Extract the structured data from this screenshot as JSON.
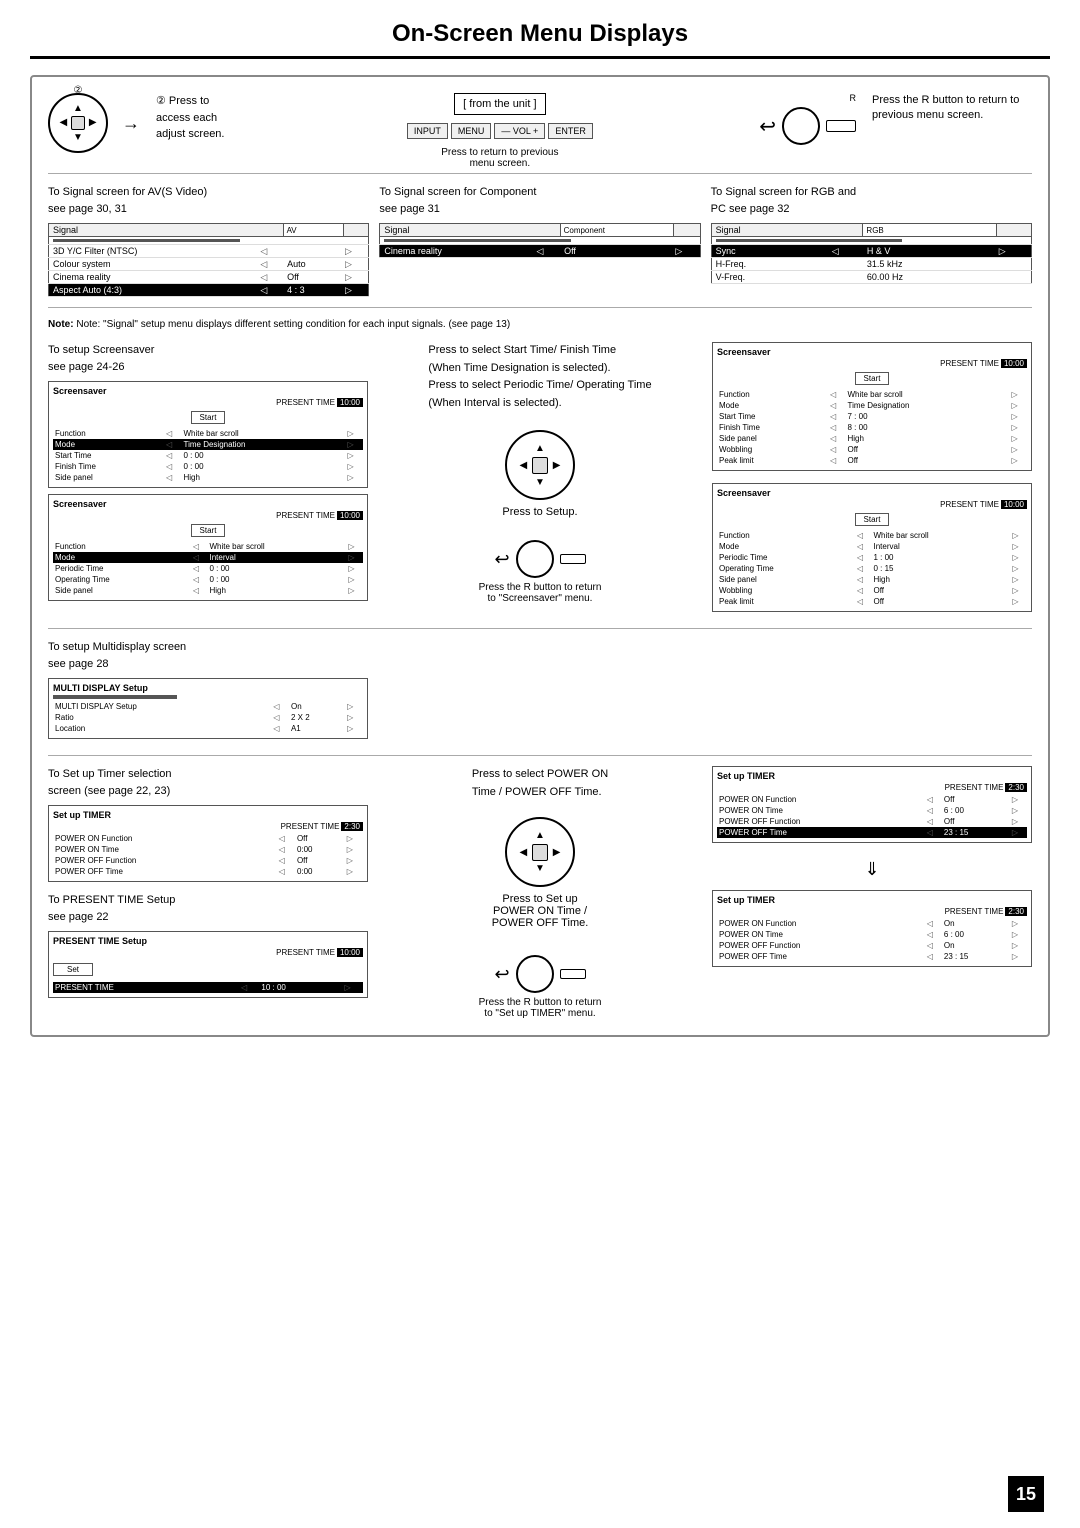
{
  "title": "On-Screen Menu Displays",
  "page_number": "15",
  "top": {
    "press_text_1": "② Press to",
    "press_text_2": "access each",
    "press_text_3": "adjust screen.",
    "from_unit_label": "[ from the unit ]",
    "unit_buttons": [
      "INPUT",
      "MENU",
      "—VOL+",
      "ENTER"
    ],
    "press_return": "Press to return to previous",
    "menu_screen": "menu screen.",
    "r_button_text": "Press the R button to return to previous menu screen."
  },
  "signal": {
    "av": {
      "label1": "To Signal screen for AV(S Video)",
      "label2": "see page 30, 31",
      "tag": "AV",
      "rows": [
        {
          "lbl": "Signal",
          "val": "AV",
          "tag": true
        },
        {
          "lbl": "3D Y/C Filter (NTSC)",
          "val": ""
        },
        {
          "lbl": "Colour system",
          "val": "Auto"
        },
        {
          "lbl": "Cinema reality",
          "val": "Off"
        },
        {
          "lbl": "Aspect Auto (4:3)",
          "val": "4 : 3"
        }
      ]
    },
    "component": {
      "label1": "To Signal screen for Component",
      "label2": "see page 31",
      "tag": "Component",
      "rows": [
        {
          "lbl": "Signal",
          "val": "Component",
          "tag": true
        },
        {
          "lbl": "Cinema reality",
          "val": "Off"
        }
      ]
    },
    "rgb": {
      "label1": "To Signal screen for RGB and",
      "label2": "PC  see page 32",
      "tag": "RGB",
      "rows": [
        {
          "lbl": "Signal",
          "val": "RGB",
          "tag": true
        },
        {
          "lbl": "Sync",
          "val": "H & V"
        },
        {
          "lbl": "H-Freq.",
          "val": "31.5 kHz"
        },
        {
          "lbl": "V-Freq.",
          "val": "60.00 Hz"
        }
      ]
    }
  },
  "note": "Note: \"Signal\" setup menu displays different setting condition for each input signals. (see page 13)",
  "screensaver": {
    "label1": "To setup Screensaver",
    "label2": "see page 24-26",
    "center_label1": "Press to select Start Time/ Finish Time",
    "center_label2": "(When Time Designation is selected).",
    "center_label3": "Press to select Periodic Time/ Operating Time",
    "center_label4": "(When Interval  is selected).",
    "press_setup": "Press to Setup.",
    "press_return": "Press the R button to return",
    "press_return2": "to \"Screensaver\" menu.",
    "screen1": {
      "title": "Screensaver",
      "present_time": "10:00",
      "start": "Start",
      "rows": [
        {
          "lbl": "Function",
          "val": "White bar scroll",
          "highlighted": false
        },
        {
          "lbl": "Mode",
          "val": "Time Designation",
          "highlighted": true
        },
        {
          "lbl": "Start Time",
          "val": "0 : 00",
          "highlighted": false
        },
        {
          "lbl": "Finish Time",
          "val": "0 : 00",
          "highlighted": false
        },
        {
          "lbl": "Side panel",
          "val": "High",
          "highlighted": false
        }
      ]
    },
    "screen2": {
      "title": "Screensaver",
      "present_time": "10:00",
      "start": "Start",
      "rows": [
        {
          "lbl": "Function",
          "val": "White bar scroll",
          "highlighted": false
        },
        {
          "lbl": "Mode",
          "val": "Interval",
          "highlighted": true
        },
        {
          "lbl": "Periodic Time",
          "val": "0 : 00",
          "highlighted": false
        },
        {
          "lbl": "Operating Time",
          "val": "0 : 00",
          "highlighted": false
        },
        {
          "lbl": "Side panel",
          "val": "High",
          "highlighted": false
        }
      ]
    },
    "right_screen1": {
      "title": "Screensaver",
      "present_time": "10:00",
      "start": "Start",
      "rows": [
        {
          "lbl": "Function",
          "val": "White bar scroll",
          "highlighted": false
        },
        {
          "lbl": "Mode",
          "val": "Time Designation",
          "highlighted": false
        },
        {
          "lbl": "Start Time",
          "val": "7 : 00",
          "highlighted": false
        },
        {
          "lbl": "Finish Time",
          "val": "8 : 00",
          "highlighted": false
        },
        {
          "lbl": "Side panel",
          "val": "High",
          "highlighted": false
        },
        {
          "lbl": "Wobbling",
          "val": "Off",
          "highlighted": false
        },
        {
          "lbl": "Peak limit",
          "val": "Off",
          "highlighted": false
        }
      ]
    },
    "right_screen2": {
      "title": "Screensaver",
      "present_time": "10:00",
      "start": "Start",
      "rows": [
        {
          "lbl": "Function",
          "val": "White bar scroll",
          "highlighted": false
        },
        {
          "lbl": "Mode",
          "val": "Interval",
          "highlighted": false
        },
        {
          "lbl": "Periodic Time",
          "val": "1 : 00",
          "highlighted": false
        },
        {
          "lbl": "Operating Time",
          "val": "0 : 15",
          "highlighted": false
        },
        {
          "lbl": "Side panel",
          "val": "High",
          "highlighted": false
        },
        {
          "lbl": "Wobbling",
          "val": "Off",
          "highlighted": false
        },
        {
          "lbl": "Peak limit",
          "val": "Off",
          "highlighted": false
        }
      ]
    }
  },
  "multidisplay": {
    "label1": "To setup Multidisplay screen",
    "label2": "see page 28",
    "screen": {
      "title": "MULTI DISPLAY Setup",
      "rows": [
        {
          "lbl": "MULTI DISPLAY Setup",
          "val": "On"
        },
        {
          "lbl": "Ratio",
          "val": "2 X 2"
        },
        {
          "lbl": "Location",
          "val": "A1"
        }
      ]
    }
  },
  "timer": {
    "label1": "To Set up Timer selection",
    "label2": "screen (see page 22, 23)",
    "center_label1": "Press to select POWER ON",
    "center_label2": "Time / POWER OFF Time.",
    "press_setup1": "Press to Set up",
    "press_setup2": "POWER ON Time /",
    "press_setup3": "POWER OFF Time.",
    "press_return1": "Press the R button to return",
    "press_return2": "to \"Set up TIMER\" menu.",
    "screen_initial": {
      "title": "Set up TIMER",
      "present_time": "2:30",
      "rows": [
        {
          "lbl": "POWER ON Function",
          "val": "Off"
        },
        {
          "lbl": "POWER ON Time",
          "val": "0:00"
        },
        {
          "lbl": "POWER OFF Function",
          "val": "Off"
        },
        {
          "lbl": "POWER OFF Time",
          "val": "0:00"
        }
      ]
    },
    "screen_after1": {
      "title": "Set up TIMER",
      "present_time": "2:30",
      "rows": [
        {
          "lbl": "POWER ON Function",
          "val": "Off"
        },
        {
          "lbl": "POWER ON Time",
          "val": "6 : 00"
        },
        {
          "lbl": "POWER OFF Function",
          "val": "Off"
        },
        {
          "lbl": "POWER OFF Time",
          "val": "23 : 15"
        }
      ]
    },
    "screen_after2": {
      "title": "Set up TIMER",
      "present_time": "2:30",
      "rows": [
        {
          "lbl": "POWER ON Function",
          "val": "On"
        },
        {
          "lbl": "POWER ON Time",
          "val": "6 : 00"
        },
        {
          "lbl": "POWER OFF Function",
          "val": "On"
        },
        {
          "lbl": "POWER OFF Time",
          "val": "23 : 15"
        }
      ]
    }
  },
  "present_time_setup": {
    "label1": "To PRESENT TIME Setup",
    "label2": "see page 22",
    "screen": {
      "title": "PRESENT TIME Setup",
      "present_time": "10:00",
      "set_btn": "Set",
      "rows": [
        {
          "lbl": "PRESENT TIME",
          "val": "10 : 00"
        }
      ]
    }
  }
}
